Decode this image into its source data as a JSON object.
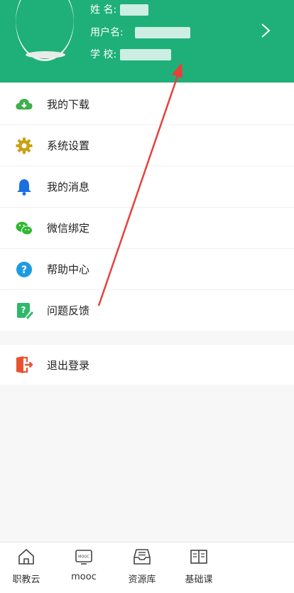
{
  "header": {
    "name_label": "姓  名:",
    "username_label": "用户名:",
    "school_label": "学  校:"
  },
  "menu": [
    {
      "label": "我的下载",
      "icon": "cloud-download-icon",
      "color": "#3fb04a"
    },
    {
      "label": "系统设置",
      "icon": "gear-icon",
      "color": "#c9a113"
    },
    {
      "label": "我的消息",
      "icon": "bell-icon",
      "color": "#1a6fe0"
    },
    {
      "label": "微信绑定",
      "icon": "wechat-icon",
      "color": "#2eb82e"
    },
    {
      "label": "帮助中心",
      "icon": "help-icon",
      "color": "#1e9be0"
    },
    {
      "label": "问题反馈",
      "icon": "feedback-icon",
      "color": "#2eb86a"
    }
  ],
  "logout": {
    "label": "退出登录",
    "icon": "logout-icon",
    "color": "#e8532f"
  },
  "tabs": [
    {
      "label": "职教云",
      "icon": "home-icon"
    },
    {
      "label": "mooc",
      "icon": "mooc-icon"
    },
    {
      "label": "资源库",
      "icon": "inbox-icon"
    },
    {
      "label": "基础课",
      "icon": "book-icon"
    }
  ],
  "colors": {
    "header_bg": "#1fb07a",
    "arrow": "#e8403b"
  }
}
